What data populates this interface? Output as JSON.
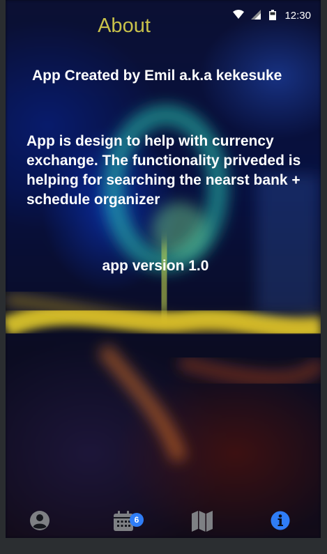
{
  "status_bar": {
    "time": "12:30",
    "icons": [
      "wifi-icon",
      "signal-icon",
      "battery-icon"
    ]
  },
  "header": {
    "title": "About",
    "title_color": "#c9c24b"
  },
  "about": {
    "creator": "App Created by Emil a.k.a kekesuke",
    "description": "App is design to help with currency exchange. The functionality priveded is helping for searching the nearst bank + schedule organizer",
    "version": "app version 1.0"
  },
  "bottom_nav": {
    "items": [
      {
        "icon": "account-icon",
        "active": false
      },
      {
        "icon": "calendar-icon",
        "active": false,
        "badge": "6"
      },
      {
        "icon": "map-icon",
        "active": false
      },
      {
        "icon": "info-icon",
        "active": true
      }
    ],
    "active_color": "#2f7df6",
    "inactive_color": "#7e8084"
  }
}
